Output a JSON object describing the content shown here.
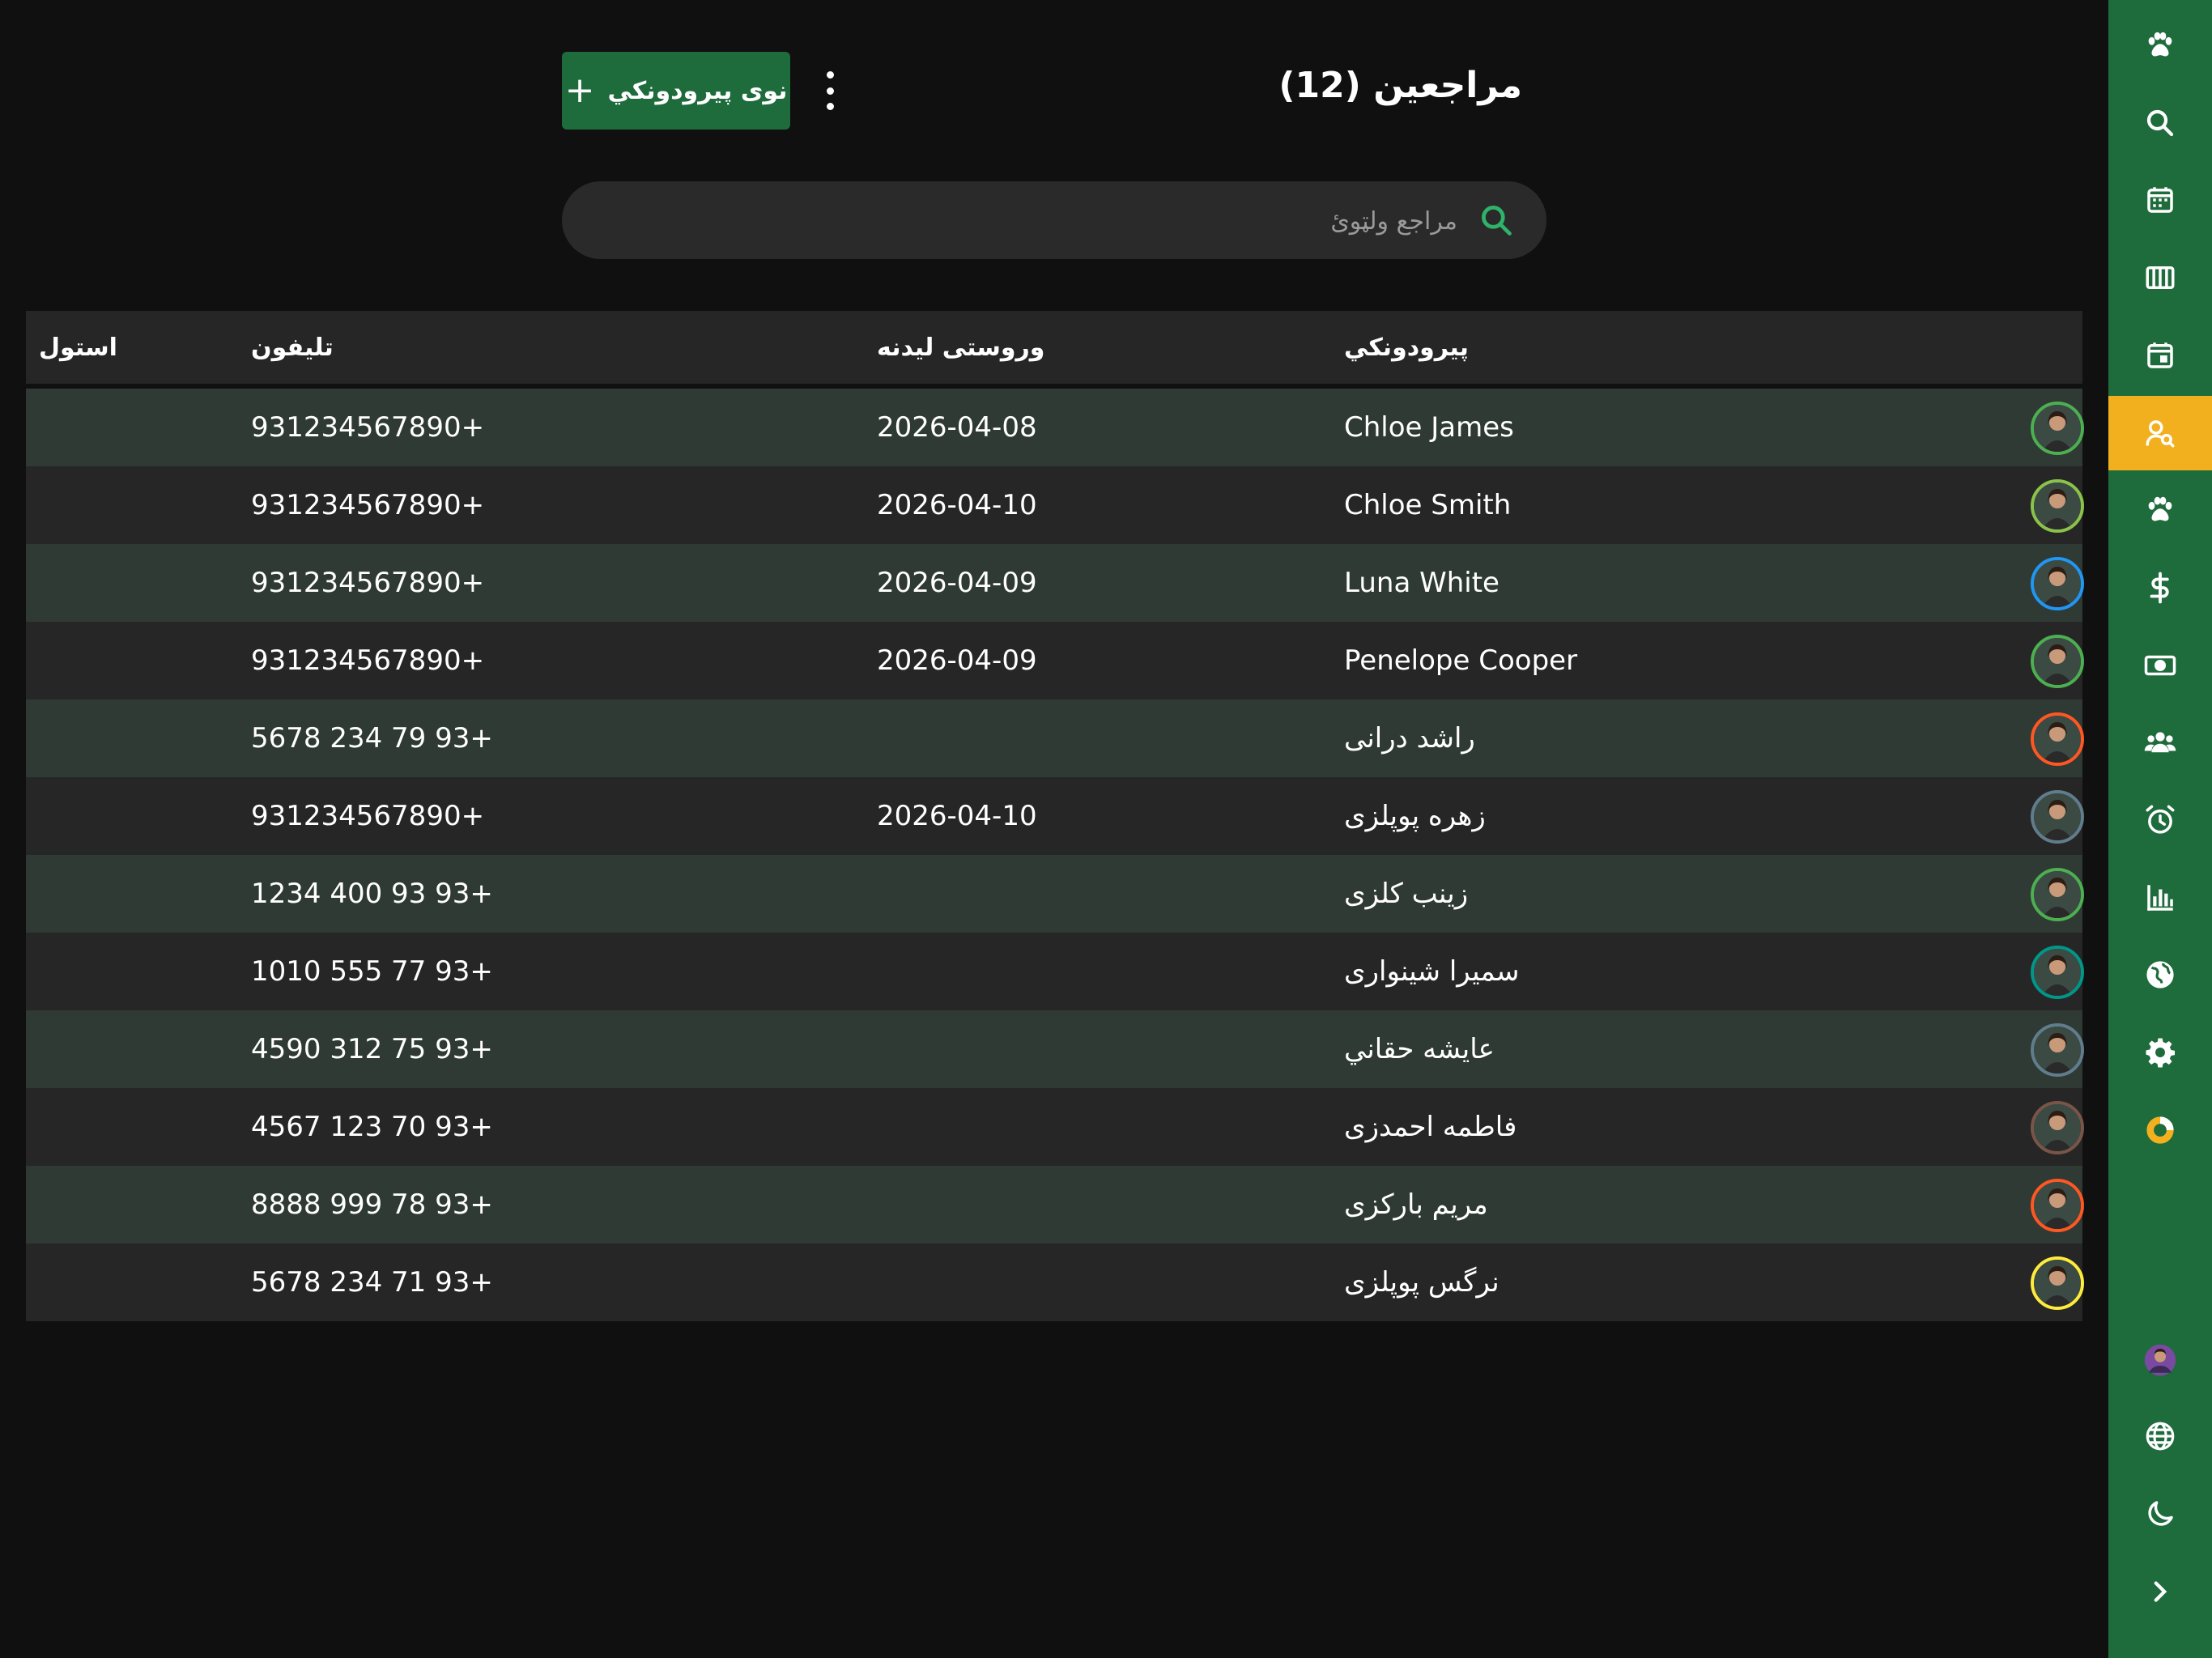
{
  "header": {
    "title": "مراجعین (12)",
    "new_button_label": "نوی پیرودونکي",
    "more_icon": "kebab-menu-icon"
  },
  "search": {
    "placeholder": "مراجع ولټوئ",
    "icon": "search-icon"
  },
  "table": {
    "columns": {
      "client": "پیرودونکي",
      "last_visit": "وروستی لیدنه",
      "phone": "تلیفون",
      "pets": "استول"
    },
    "rows": [
      {
        "name": "Chloe James",
        "last_visit": "2026-04-08",
        "phone": "931234567890+",
        "avatar_ring": "#4caf50"
      },
      {
        "name": "Chloe Smith",
        "last_visit": "2026-04-10",
        "phone": "931234567890+",
        "avatar_ring": "#8bc34a"
      },
      {
        "name": "Luna White",
        "last_visit": "2026-04-09",
        "phone": "931234567890+",
        "avatar_ring": "#2196f3"
      },
      {
        "name": "Penelope Cooper",
        "last_visit": "2026-04-09",
        "phone": "931234567890+",
        "avatar_ring": "#4caf50"
      },
      {
        "name": "راشد درانی",
        "last_visit": "",
        "phone": "5678 234 79 93+",
        "avatar_ring": "#ff5722"
      },
      {
        "name": "زهره پوپلزی",
        "last_visit": "2026-04-10",
        "phone": "931234567890+",
        "avatar_ring": "#607d8b"
      },
      {
        "name": "زینب کلزی",
        "last_visit": "",
        "phone": "1234 400 93 93+",
        "avatar_ring": "#4caf50"
      },
      {
        "name": "سمیرا شینواری",
        "last_visit": "",
        "phone": "1010 555 77 93+",
        "avatar_ring": "#009688"
      },
      {
        "name": "عایشه حقاني",
        "last_visit": "",
        "phone": "4590 312 75 93+",
        "avatar_ring": "#607d8b"
      },
      {
        "name": "فاطمه احمدزی",
        "last_visit": "",
        "phone": "4567 123 70 93+",
        "avatar_ring": "#795548"
      },
      {
        "name": "مریم بارکزی",
        "last_visit": "",
        "phone": "8888 999 78 93+",
        "avatar_ring": "#ff5722"
      },
      {
        "name": "نرگس پوپلزی",
        "last_visit": "",
        "phone": "5678 234 71 93+",
        "avatar_ring": "#ffeb3b"
      }
    ]
  },
  "sidebar": {
    "items": [
      {
        "icon": "paw-icon",
        "active": false
      },
      {
        "icon": "search-icon",
        "active": false
      },
      {
        "icon": "calendar-icon",
        "active": false
      },
      {
        "icon": "columns-icon",
        "active": false
      },
      {
        "icon": "calendar-event-icon",
        "active": false
      },
      {
        "icon": "user-search-icon",
        "active": true
      },
      {
        "icon": "paw-icon",
        "active": false
      },
      {
        "icon": "dollar-icon",
        "active": false
      },
      {
        "icon": "cash-icon",
        "active": false
      },
      {
        "icon": "users-icon",
        "active": false
      },
      {
        "icon": "alarm-icon",
        "active": false
      },
      {
        "icon": "bar-chart-icon",
        "active": false
      },
      {
        "icon": "globe-icon",
        "active": false
      },
      {
        "icon": "gear-icon",
        "active": false
      },
      {
        "icon": "donut-icon",
        "active": false
      }
    ],
    "bottom": [
      {
        "icon": "user-avatar"
      },
      {
        "icon": "language-icon"
      },
      {
        "icon": "moon-icon"
      },
      {
        "icon": "chevron-right-icon"
      }
    ]
  },
  "colors": {
    "background": "#101010",
    "sidebar": "#1e6b3c",
    "sidebar_active": "#f2b01e",
    "row_odd": "#2f3a34",
    "row_even": "#262626",
    "accent_green": "#2fb36b"
  }
}
